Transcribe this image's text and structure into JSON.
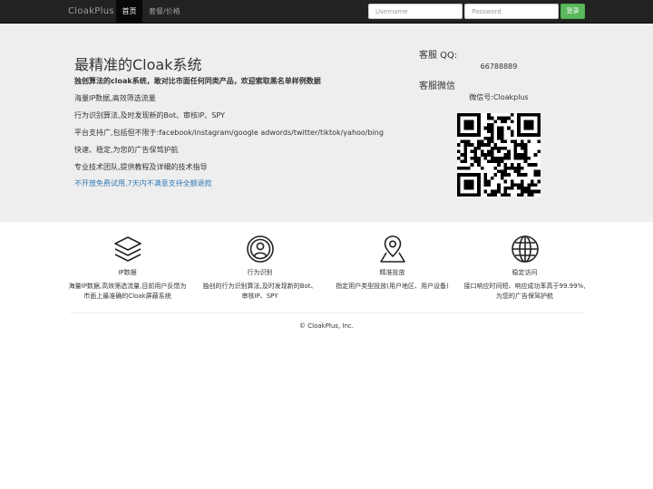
{
  "nav": {
    "brand": "CloakPlus",
    "home_label": "首页",
    "pricing_label": "套餐/价格",
    "username_placeholder": "Username",
    "password_placeholder": "Password",
    "login_label": "登录"
  },
  "hero": {
    "title": "最精准的Cloak系统",
    "subtitle": "独创算法的cloak系统，敢对比市面任何同类产品，欢迎索取黑名单样例数据",
    "features": [
      "海量IP数据,高效筛选流量",
      "行为识别算法,及时发现新的Bot、审核IP、SPY",
      "平台支持广,包括但不限于:facebook/instagram/google adwords/twitter/tiktok/yahoo/bing",
      "快速、稳定,为您的广告保驾护航",
      "专业技术团队,提供教程及详细的技术指导"
    ],
    "promo": "不开放免费试用,7天内不满意支持全额退款"
  },
  "contact": {
    "qq_label": "客服 QQ:",
    "qq_number": "66788889",
    "wechat_label": "客服微信",
    "wechat_id": "微信号:Cloakplus"
  },
  "columns": [
    {
      "icon": "layers-icon",
      "title": "IP数据",
      "desc_lines": [
        "海量IP数据,高效筛选流量,目前用户反馈为",
        "市面上最准确的Cloak屏蔽系统"
      ]
    },
    {
      "icon": "user-circle-icon",
      "title": "行为识别",
      "desc_lines": [
        "独创的行为识别算法,及时发现新的Bot、",
        "审核IP、SPY"
      ]
    },
    {
      "icon": "map-pin-icon",
      "title": "精准投放",
      "desc_lines": [
        "指定用户类型投放(用户地区、用户设备)"
      ]
    },
    {
      "icon": "globe-icon",
      "title": "稳定访问",
      "desc_lines": [
        "接口响应时间短、响应成功率高于99.99%,",
        "为您的广告保驾护航"
      ]
    }
  ],
  "footer": {
    "copyright": "© CloakPlus, Inc."
  },
  "colors": {
    "navbar": "#222222",
    "hero_bg": "#eeeeee",
    "login_button": "#5cb85c",
    "link": "#337ab7"
  }
}
